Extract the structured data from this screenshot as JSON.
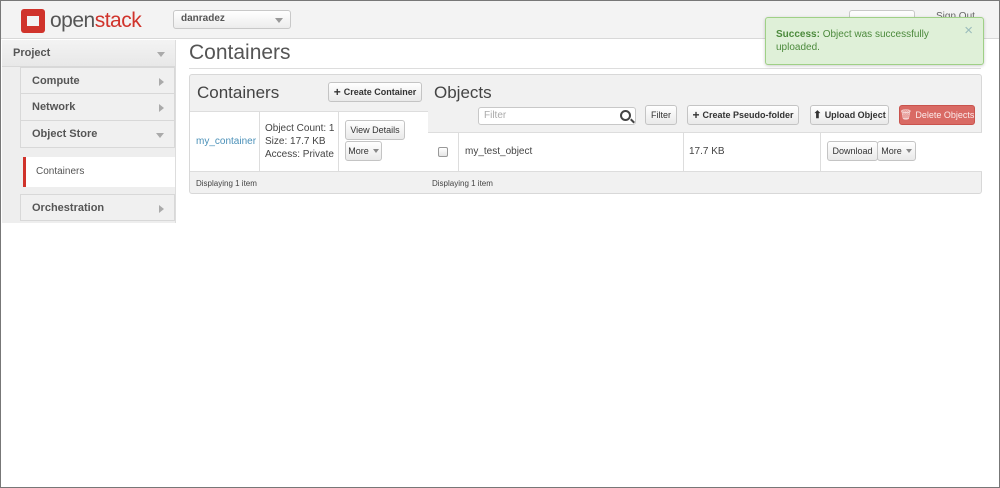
{
  "brand": {
    "logo_prefix": "open",
    "logo_suffix": "stack",
    "accent_color": "#d0332b"
  },
  "header": {
    "project_selector": "danradez",
    "sign_out": "Sign Out"
  },
  "sidebar": {
    "section": "Project",
    "groups": [
      {
        "label": "Compute"
      },
      {
        "label": "Network"
      },
      {
        "label": "Object Store"
      }
    ],
    "active_item": "Containers",
    "orchestration": "Orchestration"
  },
  "page": {
    "title": "Containers"
  },
  "containers": {
    "heading": "Containers",
    "create_label": "Create Container",
    "rows": [
      {
        "name": "my_container",
        "object_count": "Object Count: 1",
        "size": "Size: 17.7 KB",
        "access": "Access: Private",
        "view_details": "View Details",
        "more": "More"
      }
    ],
    "footer": "Displaying 1 item"
  },
  "objects": {
    "heading": "Objects",
    "filter_placeholder": "Filter",
    "filter_btn": "Filter",
    "create_folder": "Create Pseudo-folder",
    "upload": "Upload Object",
    "delete": "Delete Objects",
    "rows": [
      {
        "name": "my_test_object",
        "size": "17.7 KB",
        "download": "Download",
        "more": "More"
      }
    ],
    "footer": "Displaying 1 item"
  },
  "alert": {
    "title": "Success:",
    "message": "Object was successfully uploaded.",
    "close": "×",
    "color": "#dff0d8"
  }
}
